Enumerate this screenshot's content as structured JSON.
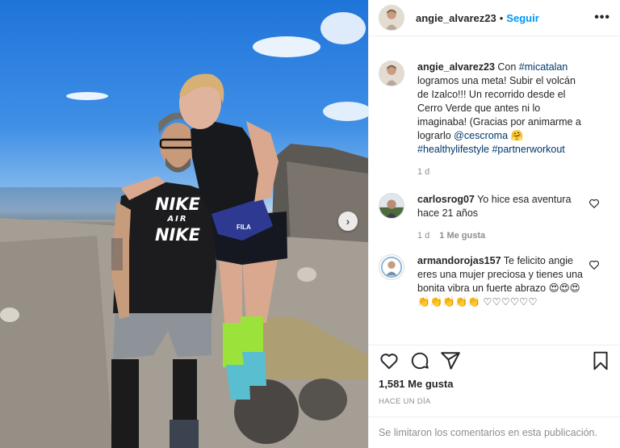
{
  "post": {
    "username": "angie_alvarez23",
    "separator": "•",
    "follow_label": "Seguir",
    "more_icon": "more-options-icon"
  },
  "caption": {
    "username": "angie_alvarez23",
    "text_1": " Con ",
    "tag_1": "#micatalan",
    "text_2": " logramos una meta! Subir el volcán de Izalco!!! Un recorrido desde el Cerro Verde que antes ni lo imaginaba! (Gracias por animarme a lograrlo ",
    "tag_2": "@cescroma",
    "text_3": " 🤗 ",
    "tag_3": "#healthylifestyle",
    "text_4": " ",
    "tag_4": "#partnerworkout",
    "time": "1 d"
  },
  "comments": [
    {
      "username": "carlosrog07",
      "text": " Yo hice esa aventura hace 21 años",
      "time": "1 d",
      "likes": "1 Me gusta"
    },
    {
      "username": "armandorojas157",
      "text": " Te felicito angie eres una mujer preciosa y tienes una bonita vibra un fuerte abrazo 😍😍😍👏👏👏👏👏 ♡♡♡♡♡♡"
    }
  ],
  "actions": {
    "likes": "1,581 Me gusta",
    "time_ago": "HACE UN DÍA"
  },
  "footer": {
    "text": "Se limitaron los comentarios en esta publicación."
  },
  "photo": {
    "shirt_text_top": "NIKE",
    "shirt_text_mid": "AIR",
    "shirt_text_bottom": "NIKE",
    "bag_text": "FILA",
    "next_icon": "chevron-right-icon"
  },
  "colors": {
    "link": "#00376b",
    "follow": "#0095f6",
    "muted": "#8e8e8e"
  }
}
